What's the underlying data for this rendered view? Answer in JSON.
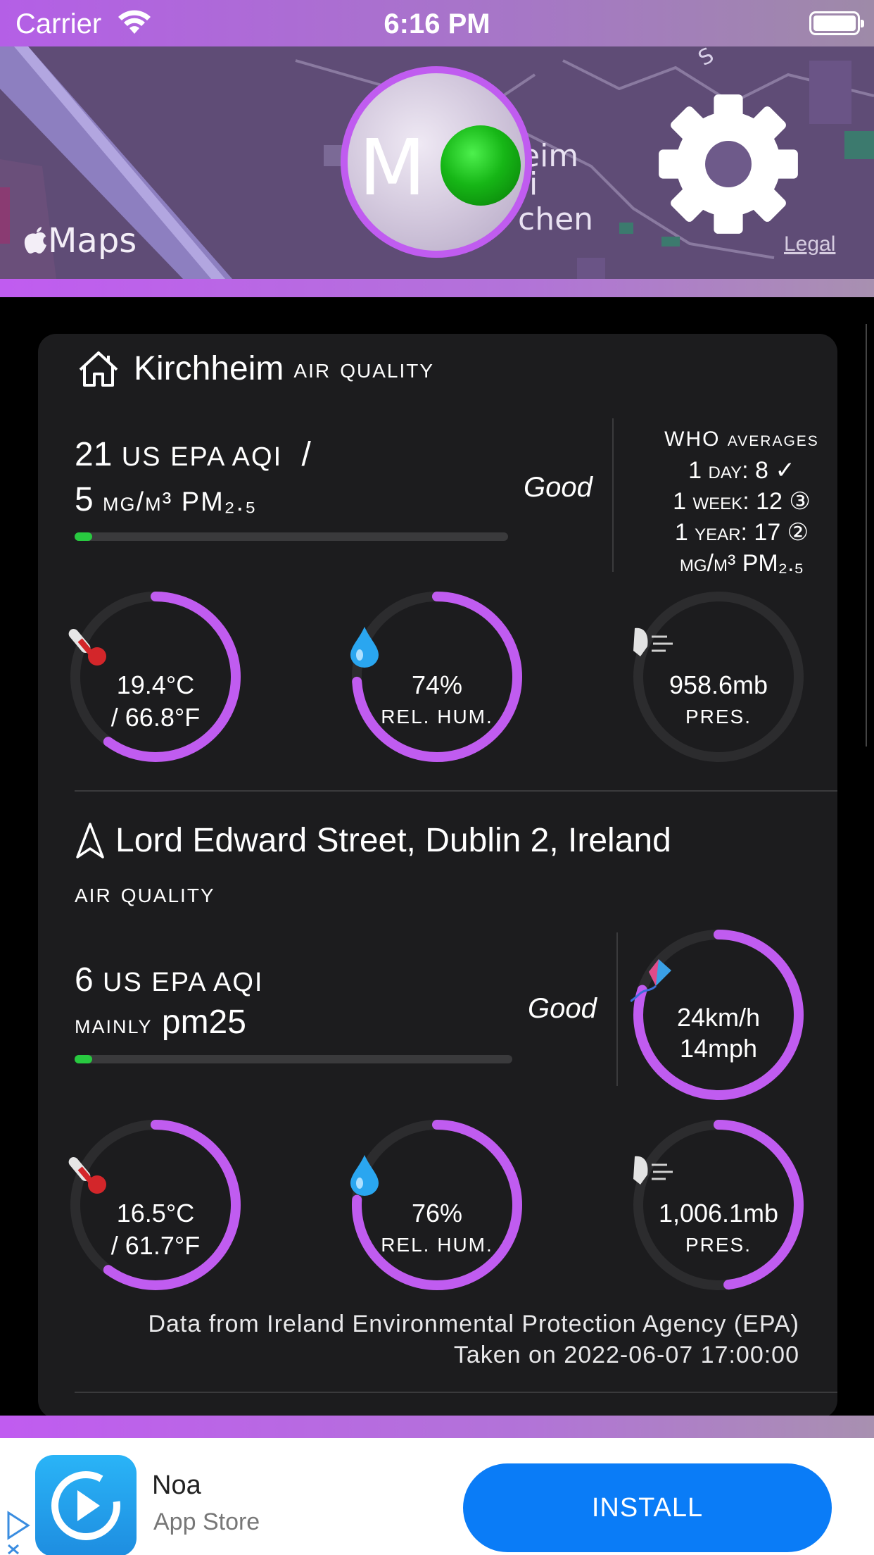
{
  "status_bar": {
    "carrier": "Carrier",
    "time": "6:16 PM"
  },
  "header": {
    "map_logo": "Maps",
    "map_legal": "Legal",
    "avatar_letter": "M",
    "avatar_status_color": "#16b616",
    "map_labels": [
      "eim",
      "i",
      "chen"
    ]
  },
  "home": {
    "place": "Kirchheim",
    "title_suffix": "air quality",
    "aqi_value": "21",
    "aqi_unit": "US EPA AQI",
    "aqi_sep": "/",
    "pm_value": "5",
    "pm_unit": "µg/m³ PM₂.₅",
    "rating": "Good",
    "aqi_bar_fraction": 0.04,
    "who": {
      "heading": "WHO averages",
      "day": "1 day: 8 ✓",
      "week": "1 week: 12 ③",
      "year": "1 year: 17 ②",
      "unit": "µg/m³ PM₂.₅"
    },
    "temperature": {
      "c": "19.4°C",
      "f": "/ 66.8°F",
      "fraction": 0.6
    },
    "humidity": {
      "value": "74%",
      "label": "REL. HUM.",
      "fraction": 0.74
    },
    "pressure": {
      "value": "958.6mb",
      "label": "PRES.",
      "fraction": 0.0
    }
  },
  "nearby": {
    "place": "Lord Edward Street, Dublin 2, Ireland",
    "title_suffix": "air quality",
    "aqi_value": "6",
    "aqi_unit": "US EPA AQI",
    "mainly_label": "mainly",
    "mainly_value": "pm25",
    "rating": "Good",
    "aqi_bar_fraction": 0.04,
    "wind": {
      "kmh": "24km/h",
      "mph": "14mph",
      "fraction": 0.8
    },
    "temperature": {
      "c": "16.5°C",
      "f": "/ 61.7°F",
      "fraction": 0.6
    },
    "humidity": {
      "value": "76%",
      "label": "REL. HUM.",
      "fraction": 0.76
    },
    "pressure": {
      "value": "1,006.1mb",
      "label": "PRES.",
      "fraction": 0.48
    },
    "source": "Data from Ireland Environmental Protection Agency (EPA)",
    "taken": "Taken on 2022-06-07 17:00:00"
  },
  "ad": {
    "name": "Noa",
    "store": "App Store",
    "install_label": "INSTALL"
  },
  "colors": {
    "accent": "#c05cf0",
    "card": "#1c1c1e",
    "good": "#28c940",
    "install": "#0a7cf7"
  }
}
